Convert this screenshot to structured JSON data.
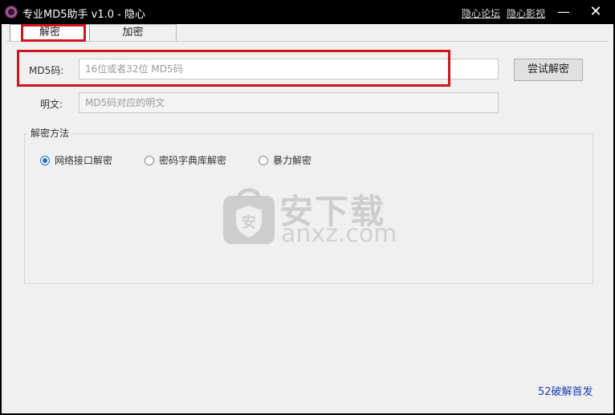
{
  "window": {
    "title": "专业MD5助手 v1.0 - 隐心",
    "links": [
      "隐心论坛",
      "隐心影视"
    ],
    "minimize_glyph": "—",
    "close_glyph": "✕"
  },
  "tabs": [
    {
      "label": "解密",
      "active": true
    },
    {
      "label": "加密",
      "active": false
    }
  ],
  "form": {
    "md5_label": "MD5码:",
    "md5_placeholder": "16位或者32位 MD5码",
    "plain_label": "明文:",
    "plain_placeholder": "MD5码对应的明文",
    "try_button": "尝试解密"
  },
  "method": {
    "title": "解密方法",
    "options": [
      {
        "label": "网络接口解密",
        "checked": true
      },
      {
        "label": "密码字典库解密",
        "checked": false
      },
      {
        "label": "暴力解密",
        "checked": false
      }
    ]
  },
  "watermark": {
    "text": "安下载",
    "sub": "anxz.com",
    "icon": "shield-bag-icon"
  },
  "footer": {
    "link": "52破解首发"
  },
  "colors": {
    "highlight": "#d0141a",
    "radio_checked": "#1b6fc8",
    "footer_link": "#1a3fb0"
  }
}
